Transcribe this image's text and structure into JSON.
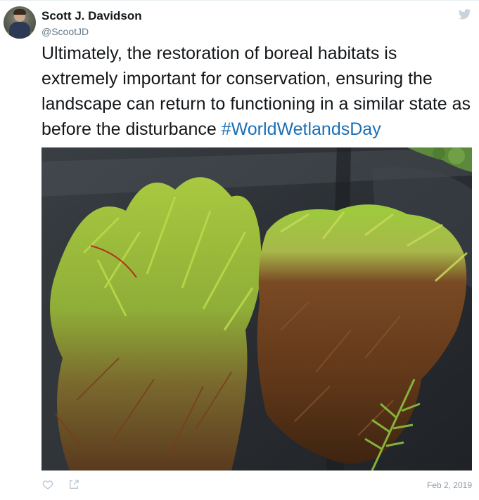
{
  "tweet": {
    "author_name": "Scott J. Davidson",
    "author_handle": "@ScootJD",
    "text": "Ultimately, the restoration of boreal habitats is extremely important for conservation, ensuring the landscape can return to functioning in a similar state as before the disturbance ",
    "hashtag": "#WorldWetlandsDay",
    "date": "Feb 2, 2019"
  },
  "icons": {
    "platform": "twitter-bird-icon",
    "like": "heart-icon",
    "share": "share-icon"
  },
  "colors": {
    "hashtag": "#1b6fb5",
    "name": "#14171a",
    "muted": "#657786",
    "twitter_icon": "#c8d3dc"
  },
  "photo": {
    "subject": "moss-photo"
  }
}
